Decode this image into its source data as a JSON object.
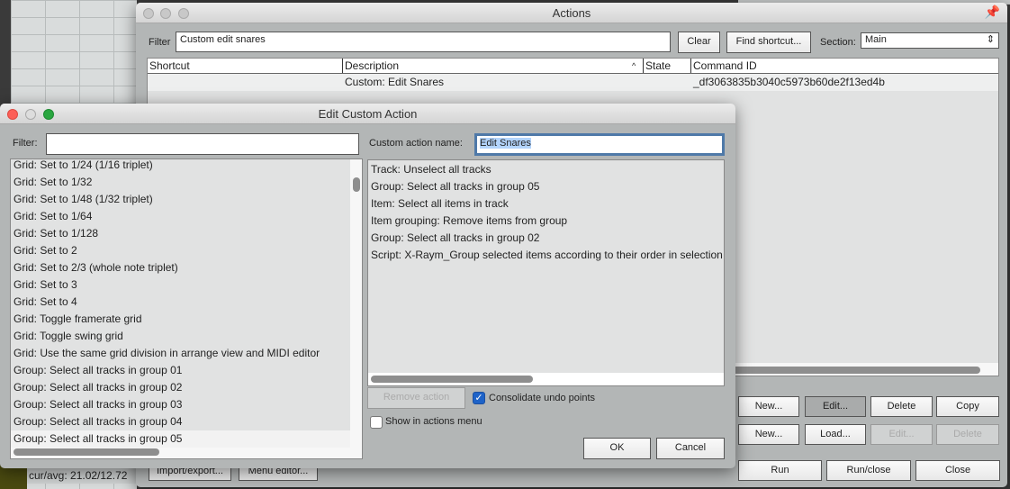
{
  "background": {
    "status_text": "cur/avg: 21.02/12.72",
    "import_export": "Import/export...",
    "menu_editor": "Menu editor..."
  },
  "actions": {
    "title": "Actions",
    "filter_label": "Filter",
    "filter_value": "Custom edit snares",
    "clear": "Clear",
    "find_shortcut": "Find shortcut...",
    "section_label": "Section:",
    "section_value": "Main",
    "columns": [
      "Shortcut",
      "Description",
      "State",
      "Command ID"
    ],
    "rows": [
      {
        "shortcut": "",
        "description": "Custom: Edit Snares",
        "state": "",
        "command_id": "_df3063835b3040c5973b60de2f13ed4b"
      }
    ],
    "custom_buttons": [
      "New...",
      "Edit...",
      "Delete",
      "Copy"
    ],
    "script_buttons": [
      "New...",
      "Load...",
      "Edit...",
      "Delete"
    ],
    "run": "Run",
    "run_close": "Run/close",
    "close": "Close"
  },
  "edit": {
    "title": "Edit Custom Action",
    "filter_label": "Filter:",
    "filter_value": "",
    "name_label": "Custom action name:",
    "name_value": "Edit Snares",
    "available": [
      "Grid: Set to 1/24 (1/16 triplet)",
      "Grid: Set to 1/32",
      "Grid: Set to 1/48 (1/32 triplet)",
      "Grid: Set to 1/64",
      "Grid: Set to 1/128",
      "Grid: Set to 2",
      "Grid: Set to 2/3 (whole note triplet)",
      "Grid: Set to 3",
      "Grid: Set to 4",
      "Grid: Toggle framerate grid",
      "Grid: Toggle swing grid",
      "Grid: Use the same grid division in arrange view and MIDI editor",
      "Group: Select all tracks in group 01",
      "Group: Select all tracks in group 02",
      "Group: Select all tracks in group 03",
      "Group: Select all tracks in group 04",
      "Group: Select all tracks in group 05"
    ],
    "selected_index": 16,
    "steps": [
      "Track: Unselect all tracks",
      "Group: Select all tracks in group 05",
      "Item: Select all items in track",
      "Item grouping: Remove items from group",
      "Group: Select all tracks in group 02",
      "Script: X-Raym_Group selected items according to their order in selection"
    ],
    "remove_action": "Remove action",
    "consolidate": "Consolidate undo points",
    "consolidate_checked": true,
    "show_in_menu": "Show in actions menu",
    "show_in_menu_checked": false,
    "ok": "OK",
    "cancel": "Cancel"
  }
}
